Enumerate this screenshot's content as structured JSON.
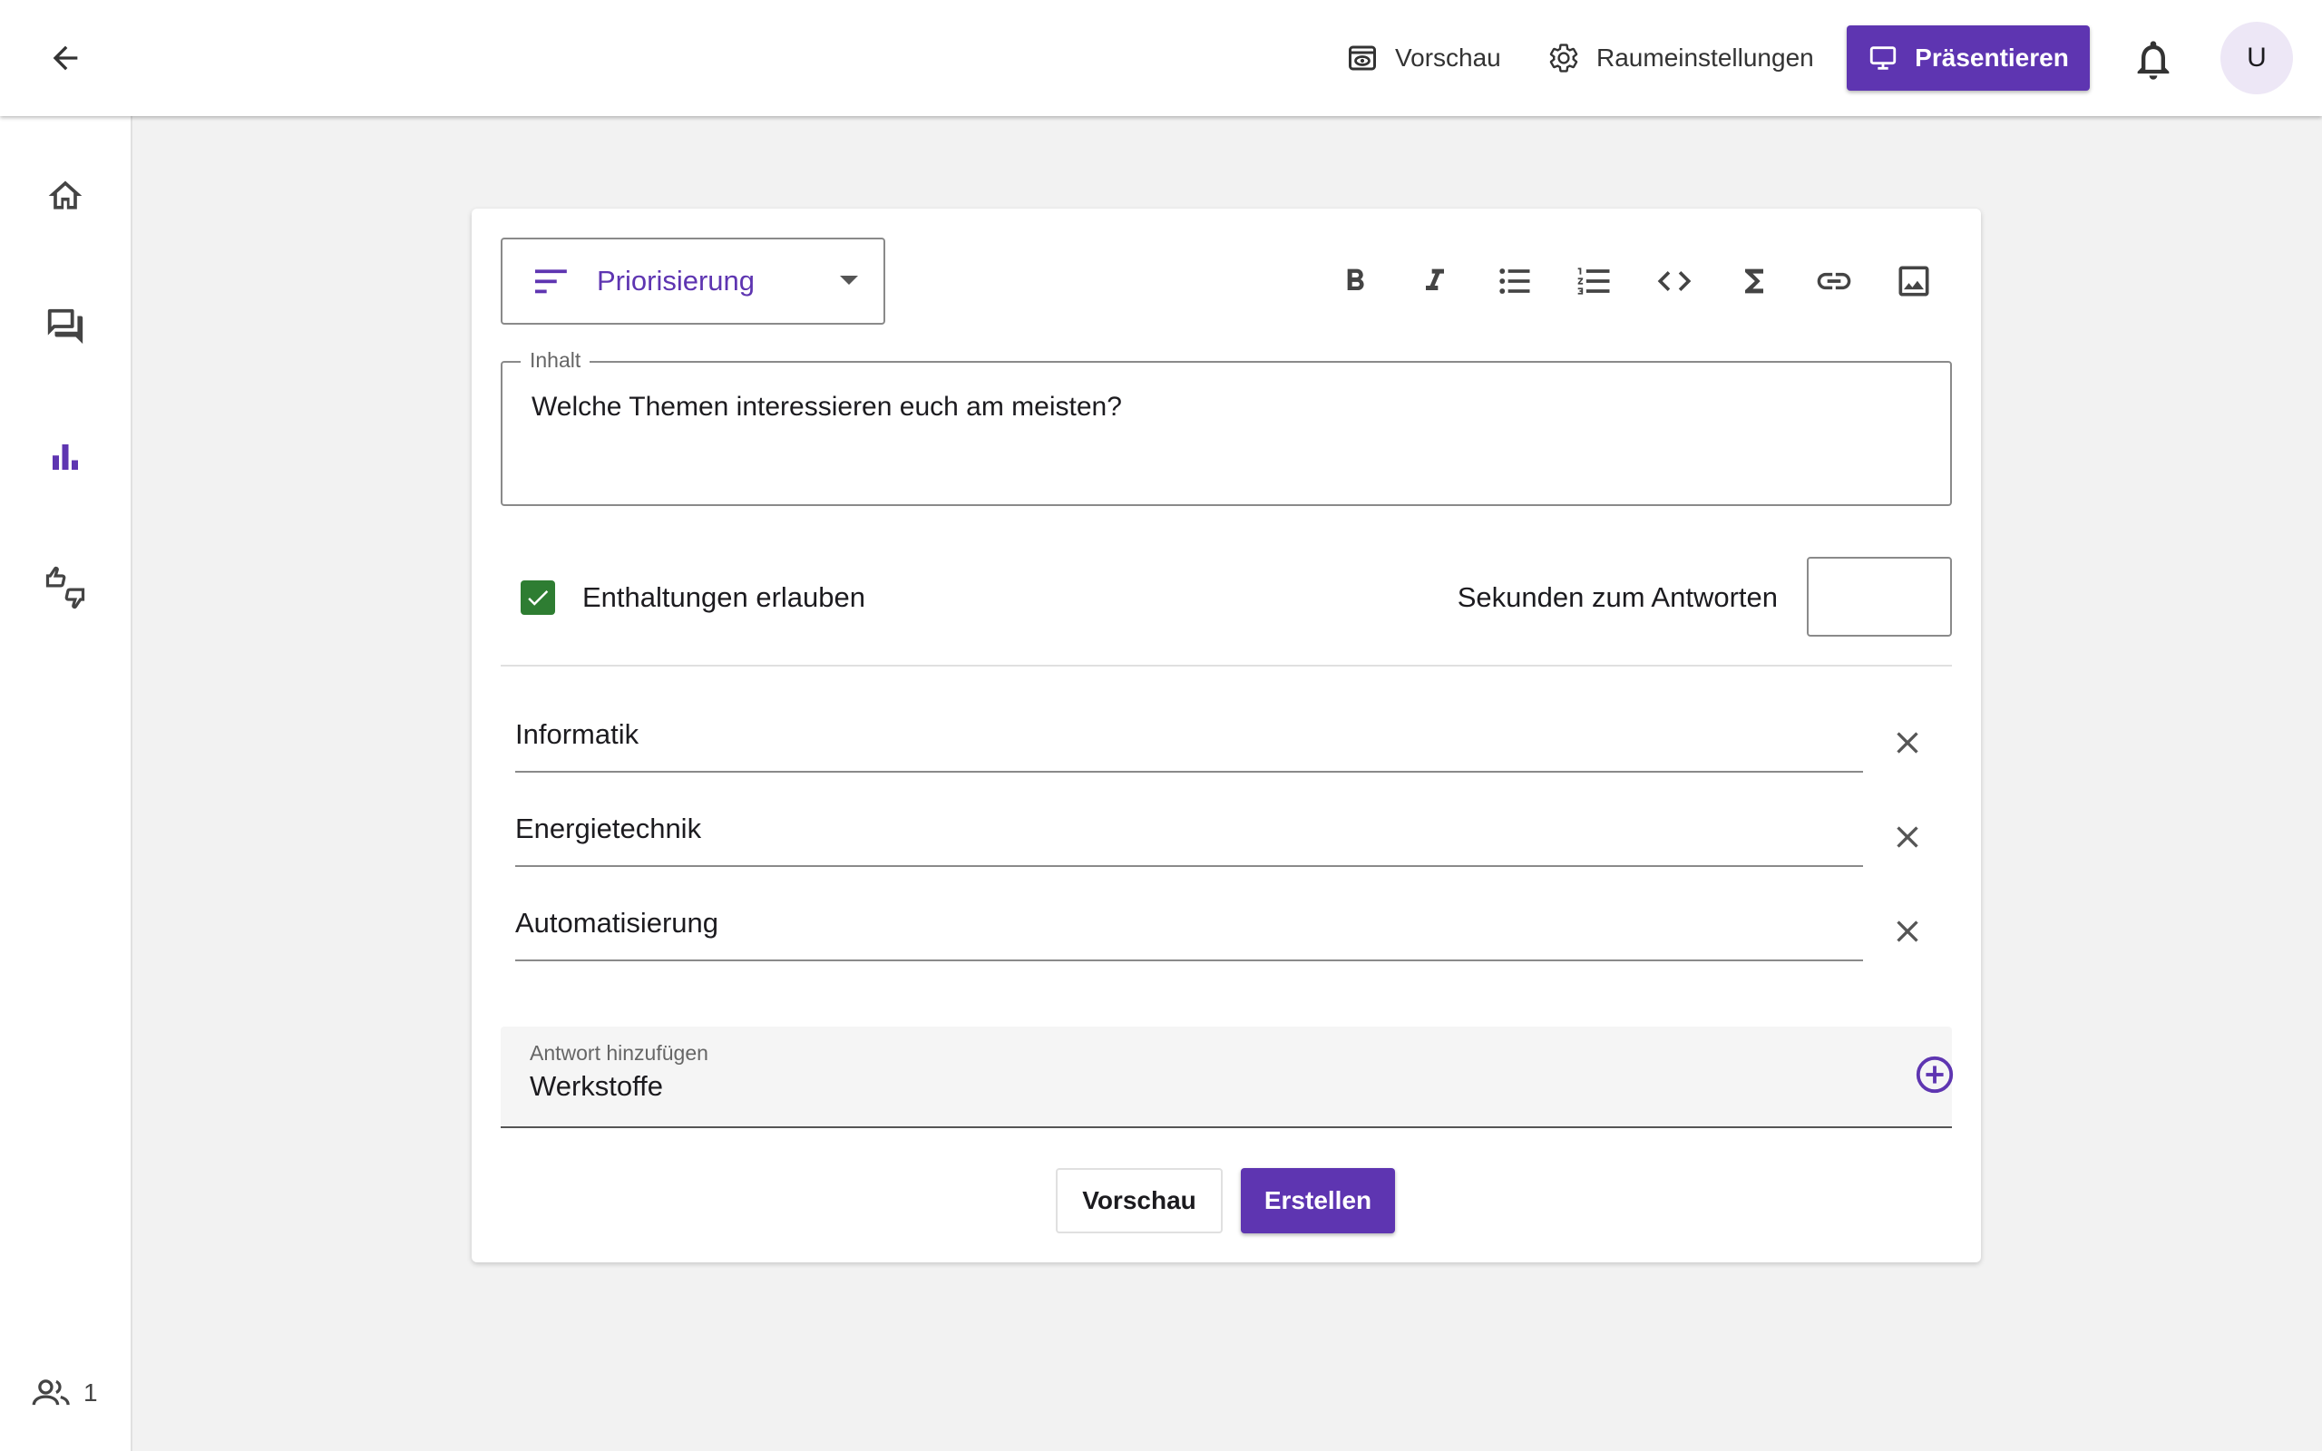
{
  "header": {
    "back_icon": "arrow-left-icon",
    "preview_label": "Vorschau",
    "settings_label": "Raumeinstellungen",
    "present_label": "Präsentieren",
    "avatar_initial": "U"
  },
  "sidebar": {
    "items": [
      {
        "icon": "home-icon"
      },
      {
        "icon": "comments-icon"
      },
      {
        "icon": "bar-chart-icon",
        "active": true
      },
      {
        "icon": "thumbs-up-down-icon"
      }
    ],
    "participants_count": "1"
  },
  "editor": {
    "format_label": "Priorisierung",
    "toolbar": [
      "bold",
      "italic",
      "bulleted-list",
      "numbered-list",
      "code",
      "sigma",
      "link",
      "image"
    ],
    "content_legend": "Inhalt",
    "content_value": "Welche Themen interessieren euch am meisten?",
    "abstentions_label": "Enthaltungen erlauben",
    "abstentions_checked": true,
    "seconds_label": "Sekunden zum Antworten",
    "answers": [
      {
        "value": "Informatik"
      },
      {
        "value": "Energietechnik"
      },
      {
        "value": "Automatisierung"
      }
    ],
    "add_answer_label": "Antwort hinzufügen",
    "add_answer_value": "Werkstoffe",
    "preview_button": "Vorschau",
    "create_button": "Erstellen"
  },
  "colors": {
    "primary": "#5e35b1",
    "checkbox": "#2e7d32",
    "avatar_bg": "#ede7f6"
  }
}
